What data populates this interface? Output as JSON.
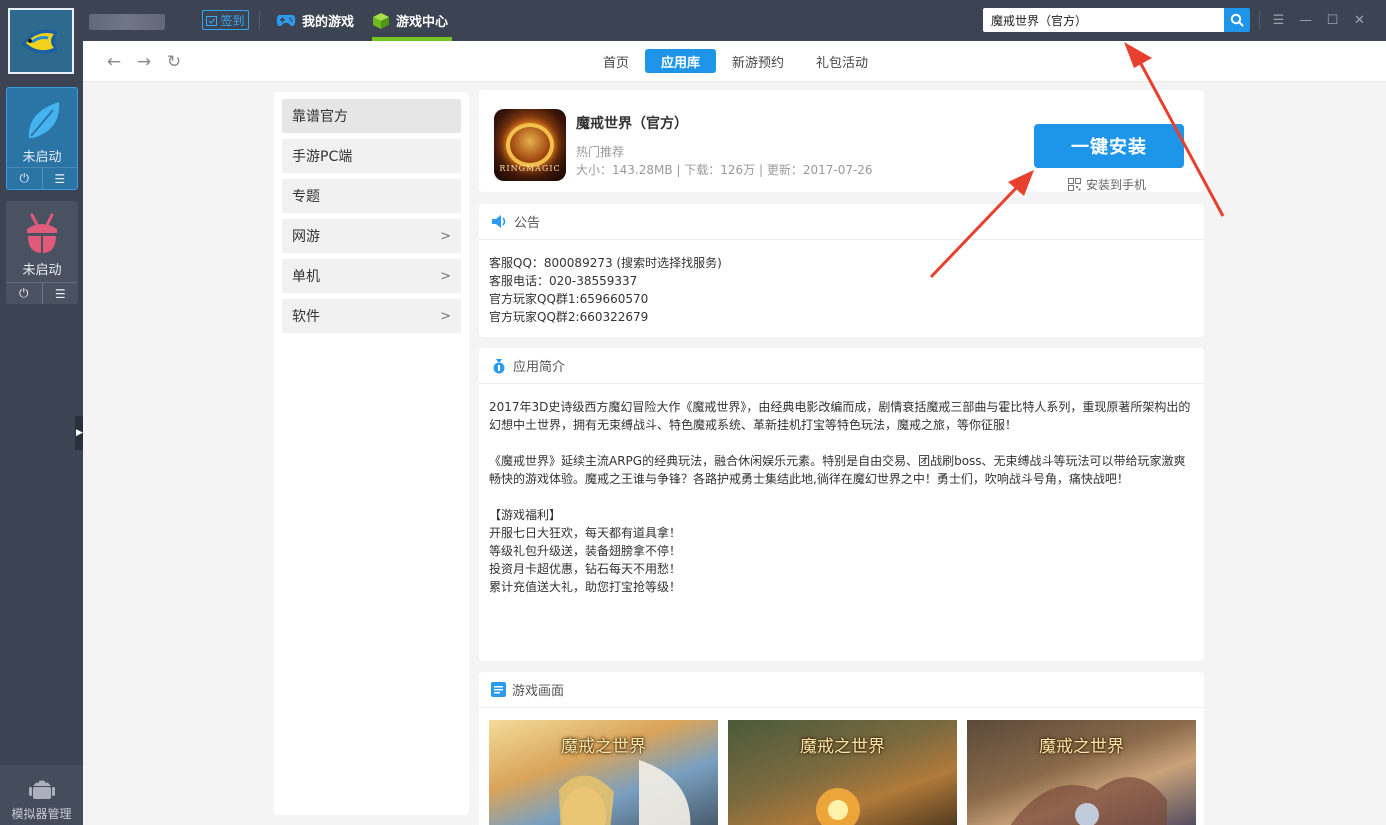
{
  "topbar": {
    "signin_label": "签到",
    "tabs": [
      {
        "label": "我的游戏"
      },
      {
        "label": "游戏中心"
      }
    ],
    "search_value": "魔戒世界（官方）"
  },
  "emulators": [
    {
      "status": "未启动"
    },
    {
      "status": "未启动"
    }
  ],
  "simulator_manager_label": "模拟器管理",
  "navbar": {
    "tabs": [
      {
        "label": "首页"
      },
      {
        "label": "应用库"
      },
      {
        "label": "新游预约"
      },
      {
        "label": "礼包活动"
      }
    ]
  },
  "categories": [
    {
      "label": "靠谱官方"
    },
    {
      "label": "手游PC端"
    },
    {
      "label": "专题"
    },
    {
      "label": "网游"
    },
    {
      "label": "单机"
    },
    {
      "label": "软件"
    }
  ],
  "app": {
    "name": "魔戒世界（官方）",
    "tag": "热门推荐",
    "meta": "大小：143.28MB | 下载：126万 | 更新：2017-07-26",
    "icon_text": "RINGMAGIC",
    "install_label": "一键安装",
    "install_phone_label": "安装到手机"
  },
  "notice": {
    "title": "公告",
    "lines": [
      "客服QQ：800089273 (搜索时选择找服务)",
      "客服电话：020-38559337",
      "官方玩家QQ群1:659660570",
      "官方玩家QQ群2:660322679"
    ]
  },
  "intro": {
    "title": "应用简介",
    "p1": "2017年3D史诗级西方魔幻冒险大作《魔戒世界》，由经典电影改编而成，剧情衰括魔戒三部曲与霍比特人系列，重现原著所架构出的幻想中土世界，拥有无束缚战斗、特色魔戒系统、革新挂机打宝等特色玩法，魔戒之旅，等你征服！",
    "p2": "《魔戒世界》延续主流ARPG的经典玩法，融合休闲娱乐元素。特别是自由交易、团战刷boss、无束缚战斗等玩法可以带给玩家激爽畅快的游戏体验。魔戒之王谁与争锋？各路护戒勇士集结此地,徜徉在魔幻世界之中！勇士们，吹响战斗号角，痛快战吧！",
    "welfare_title": "【游戏福利】",
    "welfare": [
      "开服七日大狂欢，每天都有道具拿！",
      "等级礼包升级送，装备翅膀拿不停！",
      "投资月卡超优惠，钻石每天不用愁！",
      "累计充值送大礼，助您打宝抢等级！"
    ]
  },
  "screenshots": {
    "title": "游戏画面",
    "items": [
      {
        "caption": "魔戒之世界"
      },
      {
        "caption": "魔戒之世界"
      },
      {
        "caption": "魔戒之世界"
      }
    ]
  },
  "colors": {
    "accent": "#1f95ea",
    "sidebar": "#3c4352",
    "tab_underline": "#77c224",
    "arrow": "#e8402e"
  }
}
